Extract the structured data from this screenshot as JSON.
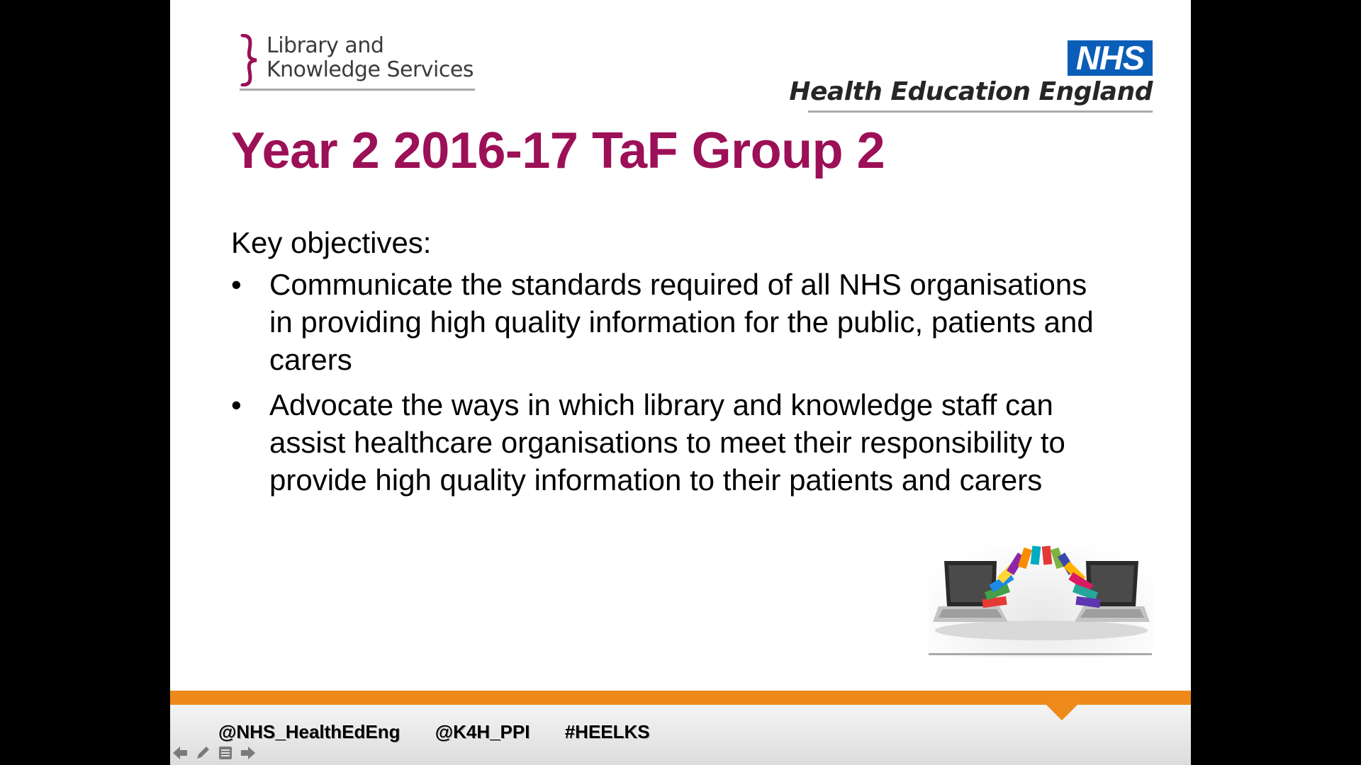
{
  "logos": {
    "lks_line1": "Library and",
    "lks_line2": "Knowledge Services",
    "nhs_badge": "NHS",
    "hee_name": "Health Education England"
  },
  "slide": {
    "title": "Year 2 2016-17 TaF Group 2",
    "heading": "Key objectives:",
    "bullet_glyph": "•",
    "objectives": [
      "Communicate the standards required of all NHS organisations in  providing high quality information for the public, patients and carers",
      "Advocate the ways in which library and knowledge staff can assist healthcare organisations to meet their responsibility to provide high quality information to their patients and carers"
    ]
  },
  "footer": {
    "handle_1": "@NHS_HealthEdEng",
    "handle_2": "@K4H_PPI",
    "hashtag": "#HEELKS"
  },
  "colors": {
    "title": "#9c1057",
    "nhs_blue": "#0b5eb8",
    "footer_orange": "#ee8a1a",
    "bracket_magenta": "#9c1057"
  },
  "controls": {
    "icons": [
      "arrow-left-icon",
      "pen-icon",
      "menu-icon",
      "arrow-right-icon"
    ]
  }
}
